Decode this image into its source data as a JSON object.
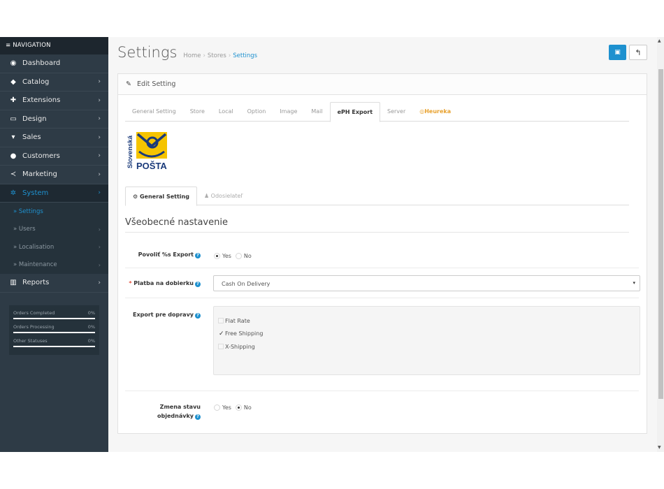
{
  "nav": {
    "header": "NAVIGATION",
    "items": [
      {
        "label": "Dashboard",
        "icon": "dashboard-icon"
      },
      {
        "label": "Catalog",
        "icon": "tag-icon"
      },
      {
        "label": "Extensions",
        "icon": "puzzle-icon"
      },
      {
        "label": "Design",
        "icon": "monitor-icon"
      },
      {
        "label": "Sales",
        "icon": "cart-icon"
      },
      {
        "label": "Customers",
        "icon": "user-icon"
      },
      {
        "label": "Marketing",
        "icon": "share-icon"
      },
      {
        "label": "System",
        "icon": "gear-icon"
      }
    ],
    "system_sub": [
      {
        "label": "» Settings"
      },
      {
        "label": "» Users"
      },
      {
        "label": "» Localisation"
      },
      {
        "label": "» Maintenance"
      }
    ],
    "reports": {
      "label": "Reports",
      "icon": "bar-chart-icon"
    },
    "stats": [
      {
        "label": "Orders Completed",
        "value": "0%"
      },
      {
        "label": "Orders Processing",
        "value": "0%"
      },
      {
        "label": "Other Statuses",
        "value": "0%"
      }
    ]
  },
  "header": {
    "title": "Settings",
    "breadcrumb": [
      "Home",
      "Stores",
      "Settings"
    ],
    "breadcrumb_sep": "›"
  },
  "panel": {
    "title": "Edit Setting",
    "tabs": [
      "General Setting",
      "Store",
      "Local",
      "Option",
      "Image",
      "Mail",
      "ePH Export",
      "Server",
      "Heureka"
    ],
    "active_tab": "ePH Export",
    "logo_text_vertical": "Slovenská",
    "logo_text": "POŠTA",
    "subtabs": [
      "General Setting",
      "Odosielateľ"
    ],
    "legend": "Všeobecné nastavenie"
  },
  "form": {
    "enable_export": {
      "label": "Povoliť %s Export",
      "yes": "Yes",
      "no": "No",
      "selected": "Yes"
    },
    "cod": {
      "required_mark": "*",
      "label": "Platba na dobierku",
      "value": "Cash On Delivery",
      "caret": "▾"
    },
    "shipping": {
      "label": "Export pre dopravy",
      "options": [
        {
          "label": "Flat Rate",
          "checked": false
        },
        {
          "label": "Free Shipping",
          "checked": true
        },
        {
          "label": "X-Shipping",
          "checked": false
        }
      ]
    },
    "status_change": {
      "label_line1": "Zmena stavu",
      "label_line2": "objednávky",
      "yes": "Yes",
      "no": "No",
      "selected": "No"
    }
  },
  "colors": {
    "accent": "#1e91cf",
    "sidebar": "#2e3b46",
    "heureka": "#e8a12e",
    "required": "#e3503e"
  }
}
